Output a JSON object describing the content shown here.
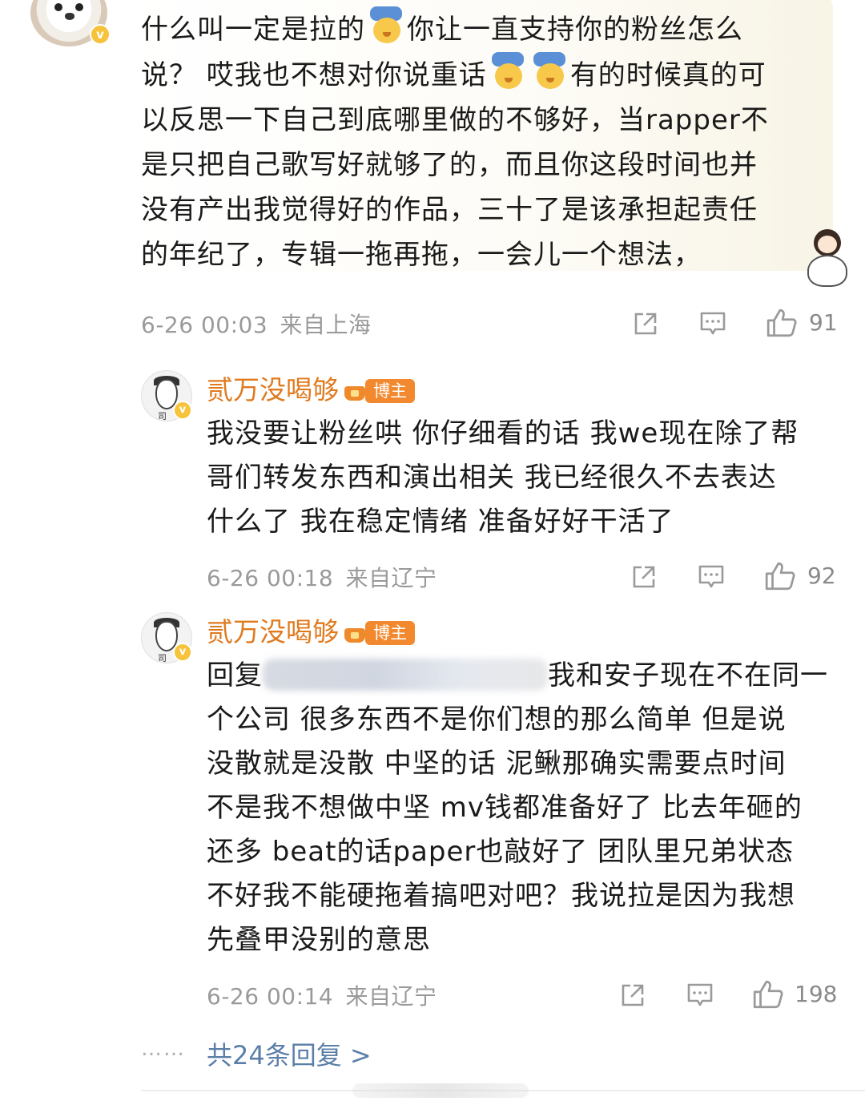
{
  "main_comment": {
    "text_lines": [
      {
        "pre": "什么叫一定是拉的",
        "post": "你让一直支持你的粉丝怎么"
      },
      {
        "pre": "说？ 哎我也不想对你说重话",
        "post": "有的时候真的可"
      },
      "以反思一下自己到底哪里做的不够好，当rapper不",
      "是只把自己歌写好就够了的，而且你这段时间也并",
      "没有产出我觉得好的作品，三十了是该承担起责任",
      "的年纪了，专辑一拖再拖，一会儿一个想法，"
    ],
    "time": "6-26 00:03",
    "location": "来自上海",
    "likes": "91"
  },
  "replies": [
    {
      "username": "贰万没喝够",
      "badge": "博主",
      "text_lines": [
        "我没要让粉丝哄 你仔细看的话 我we现在除了帮",
        "哥们转发东西和演出相关 我已经很久不去表达",
        "什么了 我在稳定情绪 准备好好干活了"
      ],
      "time": "6-26 00:18",
      "location": "来自辽宁",
      "likes": "92"
    },
    {
      "username": "贰万没喝够",
      "badge": "博主",
      "reply_prefix": "回复",
      "text_lines": [
        "我和安子现在不在同一",
        "个公司 很多东西不是你们想的那么简单 但是说",
        "没散就是没散 中坚的话 泥鳅那确实需要点时间",
        "不是我不想做中坚 mv钱都准备好了 比去年砸的",
        "还多 beat的话paper也敲好了 团队里兄弟状态",
        "不好我不能硬拖着搞吧对吧？我说拉是因为我想",
        "先叠甲没别的意思"
      ],
      "time": "6-26 00:14",
      "location": "来自辽宁",
      "likes": "198"
    }
  ],
  "more": {
    "dots": "……",
    "label": "共24条回复 >"
  },
  "icons": {
    "share": "share-icon",
    "comment": "comment-icon",
    "like": "thumbs-up-icon",
    "verified": "verified-badge-icon",
    "crown": "crown-icon"
  },
  "colors": {
    "username": "#e07a1f",
    "badge": "#f2892e",
    "link": "#5b7fa8",
    "meta": "#9a9a9a"
  }
}
